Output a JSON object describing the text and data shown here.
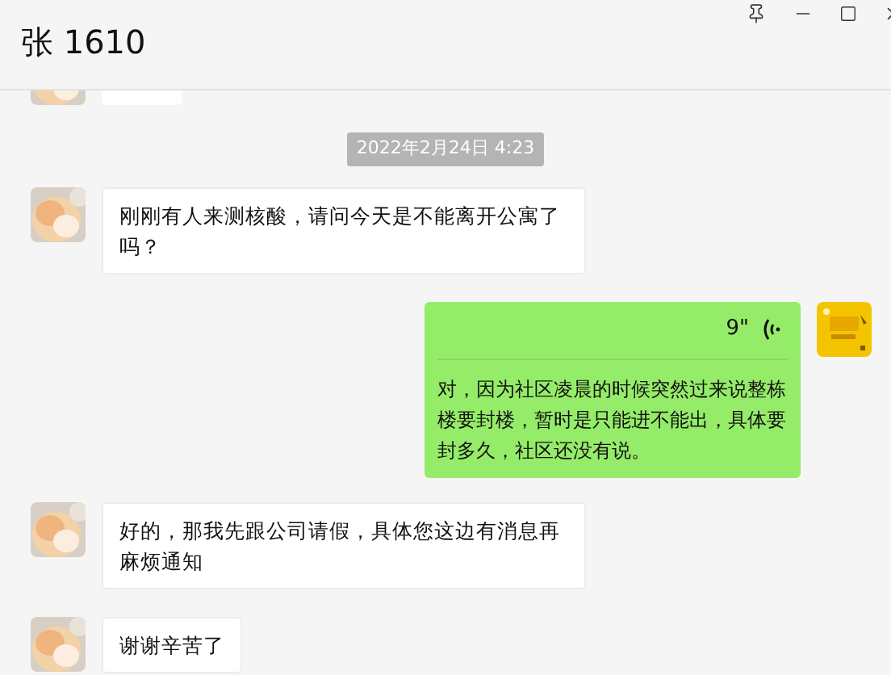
{
  "window": {
    "title": "张 1610"
  },
  "messages": [
    {
      "kind": "clipped",
      "outgoing": false
    },
    {
      "kind": "timestamp",
      "text": "2022年2月24日 4:23"
    },
    {
      "kind": "text",
      "outgoing": false,
      "text": "刚刚有人来测核酸，请问今天是不能离开公寓了吗？"
    },
    {
      "kind": "voice",
      "outgoing": true,
      "duration": "9\"",
      "transcript": "对，因为社区凌晨的时候突然过来说整栋楼要封楼，暂时是只能进不能出，具体要封多久，社区还没有说。"
    },
    {
      "kind": "text",
      "outgoing": false,
      "text": "好的，那我先跟公司请假，具体您这边有消息再麻烦通知"
    },
    {
      "kind": "text",
      "outgoing": false,
      "text": "谢谢辛苦了"
    }
  ]
}
